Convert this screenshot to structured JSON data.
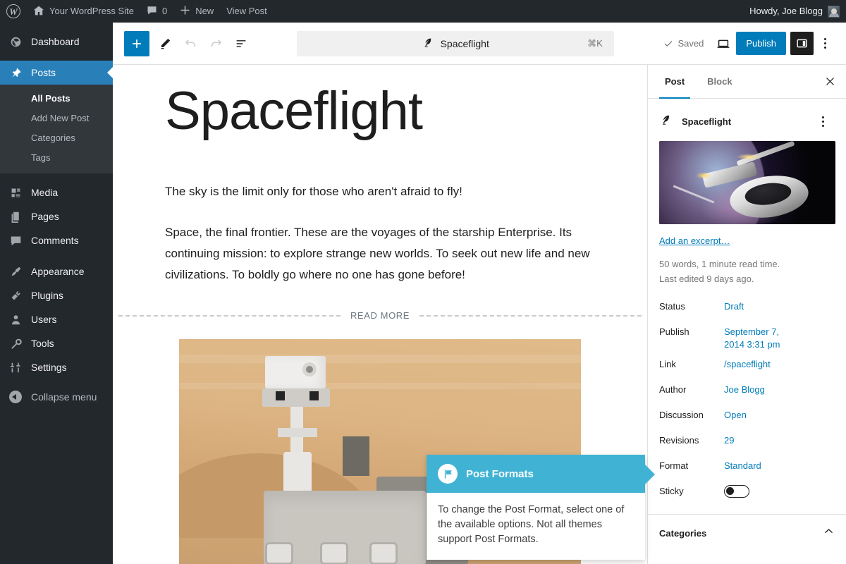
{
  "admin_bar": {
    "logo_icon": "wordpress-logo-icon",
    "site_icon": "home-icon",
    "site_name": "Your WordPress Site",
    "comments_icon": "comment-bubble-icon",
    "comments_count": "0",
    "new_icon": "plus-icon",
    "new_label": "New",
    "view_post_label": "View Post",
    "greeting": "Howdy, Joe Blogg",
    "avatar": "user-avatar"
  },
  "admin_menu": {
    "items": [
      {
        "label": "Dashboard",
        "icon": "dashboard-icon",
        "current": false
      },
      {
        "label": "Posts",
        "icon": "pin-icon",
        "current": true
      },
      {
        "label": "Media",
        "icon": "media-icon",
        "current": false
      },
      {
        "label": "Pages",
        "icon": "pages-icon",
        "current": false
      },
      {
        "label": "Comments",
        "icon": "comments-icon",
        "current": false
      },
      {
        "label": "Appearance",
        "icon": "appearance-brush-icon",
        "current": false
      },
      {
        "label": "Plugins",
        "icon": "plugins-plug-icon",
        "current": false
      },
      {
        "label": "Users",
        "icon": "users-icon",
        "current": false
      },
      {
        "label": "Tools",
        "icon": "tools-wrench-icon",
        "current": false
      },
      {
        "label": "Settings",
        "icon": "settings-sliders-icon",
        "current": false
      }
    ],
    "submenu": [
      {
        "label": "All Posts",
        "current": true
      },
      {
        "label": "Add New Post",
        "current": false
      },
      {
        "label": "Categories",
        "current": false
      },
      {
        "label": "Tags",
        "current": false
      }
    ],
    "collapse_label": "Collapse menu",
    "collapse_icon": "collapse-arrow-icon",
    "highlight_color": "#2980b9"
  },
  "editor_header": {
    "add_block_icon": "plus-icon",
    "tools_icon": "pencil-icon",
    "undo_icon": "undo-arrow-icon",
    "redo_icon": "redo-arrow-icon",
    "list_view_icon": "document-overview-icon",
    "command_center": {
      "icon": "wordpress-feather-icon",
      "value": "Spaceflight",
      "shortcut": "⌘K"
    },
    "saved_icon": "check-icon",
    "saved_label": "Saved",
    "preview_icon": "laptop-preview-icon",
    "publish_label": "Publish",
    "settings_toggle_icon": "sidebar-panel-icon",
    "options_icon": "kebab-menu-icon",
    "accent_color": "#007cba"
  },
  "canvas": {
    "title": "Spaceflight",
    "paragraph_1": "The sky is the limit only for those who aren't afraid to fly!",
    "paragraph_2": "Space, the final frontier. These are the voyages of the starship Enterprise. Its continuing mission: to explore strange new worlds. To seek out new life and new civilizations. To boldly go where no one has gone before!",
    "more_label": "READ MORE",
    "image_alt": "mars-rover-image"
  },
  "settings_sidebar": {
    "tabs": [
      {
        "label": "Post",
        "active": true
      },
      {
        "label": "Block",
        "active": false
      }
    ],
    "close_icon": "close-icon",
    "post_type_icon": "wordpress-feather-icon",
    "post_type_name": "Spaceflight",
    "post_options_icon": "kebab-menu-icon",
    "featured_image_alt": "spaceship-featured-image",
    "excerpt_link": "Add an excerpt…",
    "word_count_note": "50 words, 1 minute read time.",
    "last_edited_note": "Last edited 9 days ago.",
    "meta": [
      {
        "label": "Status",
        "value": "Draft",
        "type": "link"
      },
      {
        "label": "Publish",
        "value": "September 7, 2014 3:31 pm",
        "type": "link"
      },
      {
        "label": "Link",
        "value": "/spaceflight",
        "type": "link"
      },
      {
        "label": "Author",
        "value": "Joe Blogg",
        "type": "link"
      },
      {
        "label": "Discussion",
        "value": "Open",
        "type": "link"
      },
      {
        "label": "Revisions",
        "value": "29",
        "type": "link"
      },
      {
        "label": "Format",
        "value": "Standard",
        "type": "link"
      },
      {
        "label": "Sticky",
        "value": "",
        "type": "toggle",
        "toggle_on": false
      }
    ],
    "categories_title": "Categories",
    "categories_chevron_icon": "chevron-up-icon",
    "link_color": "#007cba"
  },
  "pointer": {
    "icon": "flag-icon",
    "title": "Post Formats",
    "body": "To change the Post Format, select one of the available options. Not all themes support Post Formats.",
    "header_color": "#40b3d4"
  }
}
